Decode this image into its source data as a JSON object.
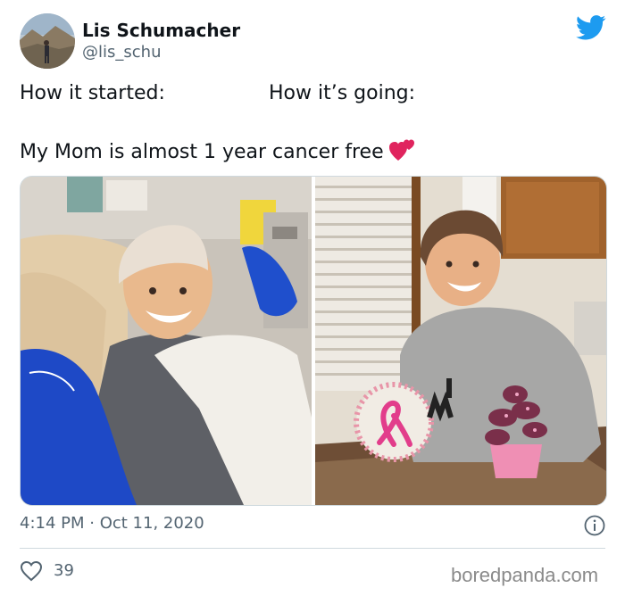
{
  "header": {
    "display_name": "Lis Schumacher",
    "handle": "@lis_schu",
    "avatar_icon": "profile-photo",
    "brand_icon": "twitter-bird-icon",
    "brand_color": "#1d9bf0"
  },
  "tweet": {
    "left_label": "How it started:",
    "right_label": "How it’s going:",
    "message": "My Mom is almost 1 year cancer free",
    "emoji_icon": "two-hearts-icon"
  },
  "media": {
    "left_photo_icon": "photo-how-it-started",
    "right_photo_icon": "photo-how-its-going"
  },
  "footer": {
    "timestamp": "4:14 PM · Oct 11, 2020",
    "info_icon": "info-icon",
    "like_icon": "heart-icon",
    "like_count": "39"
  },
  "watermark": "boredpanda.com"
}
